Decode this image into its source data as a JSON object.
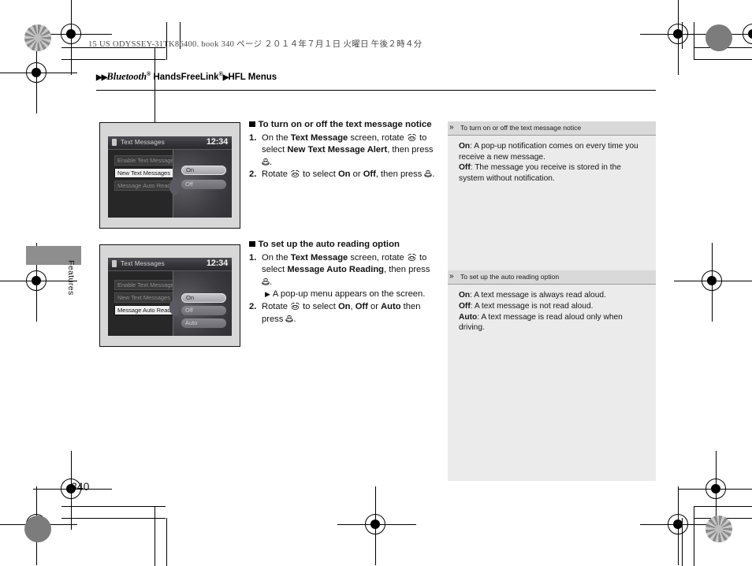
{
  "print_info": "15 US ODYSSEY-31TK86400. book   340 ページ   ２０１４年７月１日   火曜日   午後２時４分",
  "breadcrumb": {
    "arrow1": "▶▶",
    "part1": "Bluetooth",
    "sup1": "®",
    "part2": "HandsFreeLink",
    "sup2": "®",
    "arrow2": "▶",
    "part3": "HFL Menus"
  },
  "side_tab_label": "Features",
  "page_number": "340",
  "figures": [
    {
      "name": "text-messages-notice-screen",
      "titlebar": {
        "title": "Text Messages",
        "clock": "12:34"
      },
      "menu_items": [
        {
          "label": "Enable Text Message",
          "selected": false
        },
        {
          "label": "New Text Messages",
          "selected": true
        },
        {
          "label": "Message Auto Reading",
          "selected": false
        }
      ],
      "popup_options": [
        {
          "label": "On",
          "highlighted": true
        },
        {
          "label": "Off",
          "highlighted": false
        }
      ]
    },
    {
      "name": "text-messages-auto-reading-screen",
      "titlebar": {
        "title": "Text Messages",
        "clock": "12:34"
      },
      "menu_items": [
        {
          "label": "Enable Text Message",
          "selected": false
        },
        {
          "label": "New Text Messages",
          "selected": false
        },
        {
          "label": "Message Auto Reading",
          "selected": true
        }
      ],
      "popup_options": [
        {
          "label": "On",
          "highlighted": true
        },
        {
          "label": "Off",
          "highlighted": false
        },
        {
          "label": "Auto",
          "highlighted": false
        }
      ]
    }
  ],
  "instructions": [
    {
      "heading": "To turn on or off the text message notice",
      "steps": [
        {
          "seg": [
            {
              "t": "On the ",
              "b": false
            },
            {
              "t": "Text Message",
              "b": true
            },
            {
              "t": " screen, rotate ",
              "b": false
            },
            {
              "t": "@knob",
              "b": false
            },
            {
              "t": " to select ",
              "b": false
            },
            {
              "t": "New Text Message Alert",
              "b": true
            },
            {
              "t": ", then press ",
              "b": false
            },
            {
              "t": "@enter",
              "b": false
            },
            {
              "t": ".",
              "b": false
            }
          ]
        },
        {
          "seg": [
            {
              "t": "Rotate ",
              "b": false
            },
            {
              "t": "@knob",
              "b": false
            },
            {
              "t": " to select ",
              "b": false
            },
            {
              "t": "On",
              "b": true
            },
            {
              "t": " or ",
              "b": false
            },
            {
              "t": "Off",
              "b": true
            },
            {
              "t": ", then press ",
              "b": false
            },
            {
              "t": "@enter",
              "b": false
            },
            {
              "t": ".",
              "b": false
            }
          ]
        }
      ]
    },
    {
      "heading": "To set up the auto reading option",
      "steps": [
        {
          "seg": [
            {
              "t": "On the ",
              "b": false
            },
            {
              "t": "Text Message",
              "b": true
            },
            {
              "t": " screen, rotate ",
              "b": false
            },
            {
              "t": "@knob",
              "b": false
            },
            {
              "t": " to select ",
              "b": false
            },
            {
              "t": "Message Auto Reading",
              "b": true
            },
            {
              "t": ", then press ",
              "b": false
            },
            {
              "t": "@enter",
              "b": false
            },
            {
              "t": ".",
              "b": false
            }
          ],
          "subnote": "A pop-up menu appears on the screen."
        },
        {
          "seg": [
            {
              "t": "Rotate ",
              "b": false
            },
            {
              "t": "@knob",
              "b": false
            },
            {
              "t": " to select ",
              "b": false
            },
            {
              "t": "On",
              "b": true
            },
            {
              "t": ", ",
              "b": false
            },
            {
              "t": "Off",
              "b": true
            },
            {
              "t": " or ",
              "b": false
            },
            {
              "t": "Auto",
              "b": true
            },
            {
              "t": " then press ",
              "b": false
            },
            {
              "t": "@enter",
              "b": false
            },
            {
              "t": ".",
              "b": false
            }
          ]
        }
      ]
    }
  ],
  "notes": [
    {
      "title": "To turn on or off the text message notice",
      "lines": [
        {
          "term": "On",
          "sep": ": ",
          "text": "A pop-up notification comes on every time you receive a new message."
        },
        {
          "term": "Off",
          "sep": ": ",
          "text": "The message you receive is stored in the system without notification."
        }
      ]
    },
    {
      "title": "To set up the auto reading option",
      "lines": [
        {
          "term": "On",
          "sep": ": ",
          "text": "A text message is always read aloud."
        },
        {
          "term": "Off",
          "sep": ": ",
          "text": "A text message is not read aloud."
        },
        {
          "term": "Auto",
          "sep": ": ",
          "text": "A text message is read aloud only when driving."
        }
      ]
    }
  ],
  "colors": {
    "tab_gray": "#8e8e8e",
    "notes_bg": "#ebebeb",
    "note_head_bg": "#d9d9d9",
    "screen_dark": "#272727"
  }
}
